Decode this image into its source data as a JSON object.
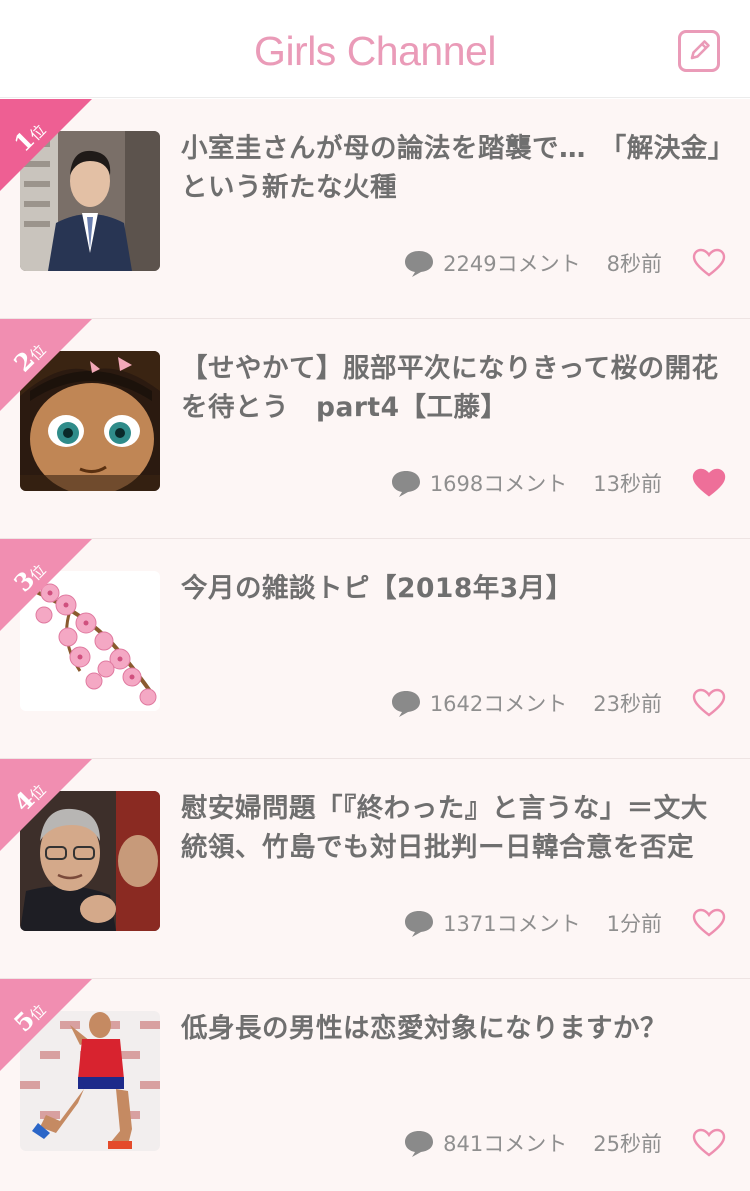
{
  "header": {
    "logo_text": "Girls Channel",
    "compose_icon": "pencil-square-icon"
  },
  "colors": {
    "accent": "#ea9bb8",
    "ribbon_1": "#ee5f93",
    "ribbon_other": "#f18eb1",
    "row_bg": "#fdf6f5"
  },
  "topics": [
    {
      "rank": "1",
      "rank_suffix": "位",
      "title": "小室圭さんが母の論法を踏襲で…　「解決金」という新たな火種",
      "comments": "2249コメント",
      "time": "8秒前",
      "liked": false
    },
    {
      "rank": "2",
      "rank_suffix": "位",
      "title": "【せやかて】服部平次になりきって桜の開花を待とう　part4【工藤】",
      "comments": "1698コメント",
      "time": "13秒前",
      "liked": true
    },
    {
      "rank": "3",
      "rank_suffix": "位",
      "title": "今月の雑談トピ【2018年3月】",
      "comments": "1642コメント",
      "time": "23秒前",
      "liked": false
    },
    {
      "rank": "4",
      "rank_suffix": "位",
      "title": "慰安婦問題「『終わった』と言うな」＝文大統領、竹島でも対日批判ー日韓合意を否定",
      "comments": "1371コメント",
      "time": "1分前",
      "liked": false
    },
    {
      "rank": "5",
      "rank_suffix": "位",
      "title": "低身長の男性は恋愛対象になりますか？",
      "comments": "841コメント",
      "time": "25秒前",
      "liked": false
    }
  ]
}
